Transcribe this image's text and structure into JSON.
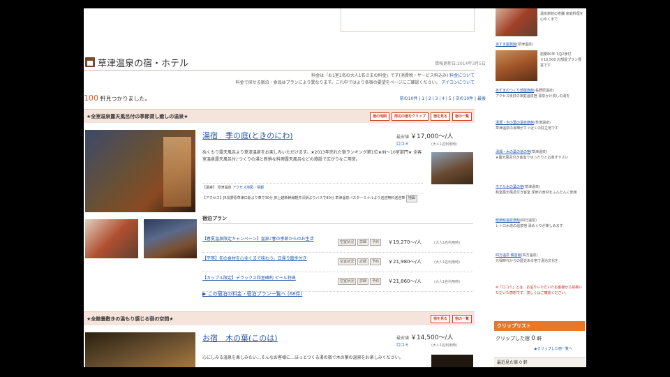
{
  "header": {
    "title": "草津温泉の宿・ホテル",
    "date": "情報更新日:2014年3月5日"
  },
  "notice": {
    "line1": "料金は「お1室1名の大人1名さまの料金」です(消費税・サービス料込み)",
    "line1_link": "料金について",
    "line2": "料金で探せる宿泊・食品はプランにより異なります。これ中ではより各宿の要望をページにご確認ください。",
    "line2_link": "アイコンについて"
  },
  "results": {
    "count": "100",
    "suffix": "軒見つかりました。",
    "pager": "前の10件 | 1 | 2 | 3 | 4 | 5 | 次の10件 | 最後"
  },
  "listing1": {
    "category": "★全室温泉露天風呂付の季節貸し癒しの温泉★",
    "buttons": [
      "宿の地図",
      "周辺の宿をクリップ",
      "宿を見る",
      "宿の一覧"
    ],
    "name": "湯宿　季の庭(ときのにわ)",
    "price_label": "最安値",
    "price": "￥17,000～/人",
    "price_sub": "口コミ",
    "price_note": "(大人1名利用時)",
    "description": "ぬくもり露天風呂より草津温泉をお楽しみいただけます。★2013年売れた宿ランキング第1位★IN～10室部門★ 全客室温泉露天風呂付♪つくりの湯と新鮮な料理露天風呂などの施設で広がりなご用意。",
    "access_label": "【最寄】",
    "access_value": "草津温泉",
    "access_link": "アクセス地図・情報",
    "area_text": "【アクセス】JR長野原草津口駅より車で30分 JR上越新幹線軽井沢駅よりバスで80分 草津温泉バスターミナルより送迎無料送迎車",
    "area_btn": "地図",
    "plan_header": "宿泊プラン",
    "plans": [
      {
        "name": "【春夏温泉限定キャンペーン】温泉♪春の季節からのお生活",
        "price": "￥19,270～/人",
        "note": "(大人1名利用時)"
      },
      {
        "name": "【平等】旬の食材を心ゆくまで味わう。日帰り散歩付き",
        "price": "￥21,980～/人",
        "note": "(大人1名利用時)"
      },
      {
        "name": "【カップル限定】デラックス和室確約 ビール特典",
        "price": "￥21,860～/人",
        "note": "(大人1名利用時)"
      }
    ],
    "plan_btns": [
      "空室状況",
      "詳細",
      "予約"
    ],
    "all_plans": "▶ この宿泊の料金・宿泊プラン一覧へ (68件)"
  },
  "listing2": {
    "category": "★全館畳敷きの温もり感じる宿の空間★",
    "buttons": [
      "宿を見る",
      "宿の一覧"
    ],
    "name": "お宿　木の葉(このは)",
    "price_label": "最安値",
    "price": "￥14,500～/人",
    "price_sub": "口コミ",
    "price_note": "(大人1名利用時)",
    "description": "心にしみる温泉を楽しみたい…そんなお客様に…ほっとつくる湯の宿で木の葉の温泉をお楽しみください。"
  },
  "sidebar": {
    "item1_text": "温泉旅館の老舗 家庭料理を心ゆくまで",
    "item2_link": "あずま屋旅館",
    "item2_tag": "(草津温泉)",
    "item2_text": "創業80年 1泊2食付￥10,500 お部屋プラン豊富です",
    "links": [
      {
        "link": "あずまのつくり部屋旅館",
        "tag": "(長野原温泉)",
        "body": "アクセス良好の家庭温泉宿 源泉かけ流しの湯を"
      },
      {
        "link": "湯畑・木の葉の温泉旅館",
        "tag": "(草津温泉)",
        "body": "草津温泉の湯畑がすぐ近くの好立地です"
      },
      {
        "link": "湯畑・木の葉の道の宿",
        "tag": "(草津温泉)",
        "body": "★露天風呂付き客室でゆったりとお寛ぎ下さい"
      },
      {
        "link": "ホテル木の葉の宿",
        "tag": "(草津温泉)",
        "body": "和室露天風呂付き客室 季節の食材をふんだんに使用"
      },
      {
        "link": "極楽館温泉旅館",
        "tag": "(四万温泉)",
        "body": "レトロ木造の温泉宿 湯めぐりが楽しめます"
      },
      {
        "link": "四万温泉 積善館",
        "tag": "(四万温泉)",
        "body": "元禄時代からの歴史ある宿で湯治文化を"
      }
    ],
    "red_note": "※「口コミ」とは、お泊りいただいたお客様から投稿いただいた感想です。詳しくはご確認ください。",
    "clip_title": "クリップリスト",
    "clip_label": "クリップした宿",
    "clip_count": "0",
    "clip_unit": "軒",
    "clip_link": "▶クリップした宿一覧へ",
    "history_label": "最近見た宿",
    "history_count": "0",
    "history_unit": "軒"
  }
}
